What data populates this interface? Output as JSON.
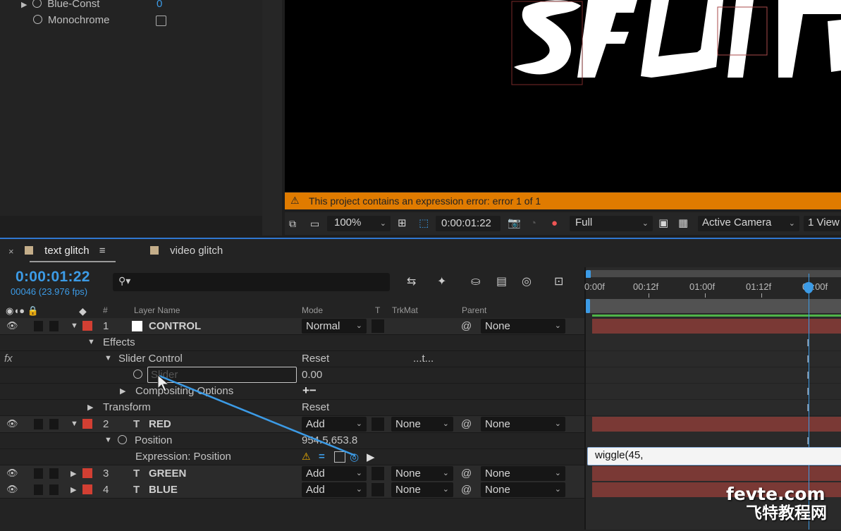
{
  "effect_controls": {
    "rows": [
      {
        "label": "Blue-Const",
        "value": "0"
      },
      {
        "label": "Monochrome"
      }
    ]
  },
  "viewer": {
    "error_text": "This project contains an expression error: error 1 of 1",
    "zoom": "100%",
    "timecode": "0:00:01:22",
    "resolution": "Full",
    "camera": "Active Camera",
    "view_layout": "1 View"
  },
  "timeline": {
    "tabs": [
      {
        "label": "text glitch",
        "active": true
      },
      {
        "label": "video glitch",
        "active": false
      }
    ],
    "timecode": "0:00:01:22",
    "frames": "00046 (23.976 fps)",
    "headers": {
      "number": "#",
      "layer_name": "Layer Name",
      "mode": "Mode",
      "t": "T",
      "trkmat": "TrkMat",
      "parent": "Parent"
    },
    "ruler": [
      "0:00f",
      "00:12f",
      "01:00f",
      "01:12f",
      "02:00f"
    ],
    "layers": [
      {
        "num": "1",
        "name": "CONTROL",
        "mode": "Normal",
        "parent": "None"
      },
      {
        "num": "2",
        "name": "RED",
        "mode": "Add",
        "trkmat": "None",
        "parent": "None"
      },
      {
        "num": "3",
        "name": "GREEN",
        "mode": "Add",
        "trkmat": "None",
        "parent": "None"
      },
      {
        "num": "4",
        "name": "BLUE",
        "mode": "Add",
        "trkmat": "None",
        "parent": "None"
      }
    ],
    "effects_label": "Effects",
    "slider_control": "Slider Control",
    "reset": "Reset",
    "ellipsis": "...t...",
    "slider_placeholder": "Slider",
    "slider_value": "0.00",
    "compositing_options": "Compositing Options",
    "plus_minus": "+−",
    "transform": "Transform",
    "position_label": "Position",
    "position_value": "954.5,653.8",
    "expression_label": "Expression: Position",
    "expression_text": "wiggle(45,"
  },
  "watermark": {
    "line1": "fevte.com",
    "line2": "飞特教程网"
  },
  "colors": {
    "accent": "#3c9be6",
    "error_bar": "#e07b00",
    "label_red": "#d23f33",
    "track": "#7a3935"
  }
}
